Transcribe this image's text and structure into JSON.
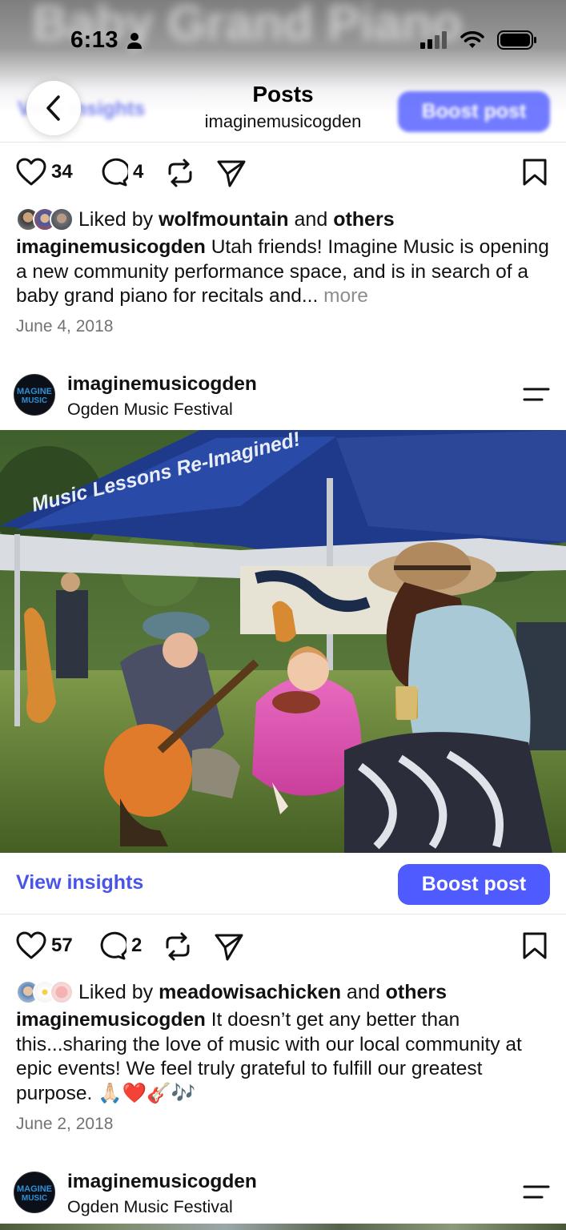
{
  "status_bar": {
    "time": "6:13"
  },
  "background_title": "Baby Grand Piano",
  "nav": {
    "title": "Posts",
    "subtitle": "imaginemusicogden",
    "ghost_left": "View insights",
    "ghost_boost": "Boost post"
  },
  "post1": {
    "likes": "34",
    "comments": "4",
    "liked_prefix": "Liked by",
    "liked_user": "wolfmountain",
    "liked_and": "and",
    "liked_others": "others",
    "caption_user": "imaginemusicogden",
    "caption_text": " Utah friends! Imagine Music is opening a new community performance space, and is in search of a baby grand piano for recitals and... ",
    "more_label": "more",
    "date": "June 4, 2018"
  },
  "post2": {
    "username": "imaginemusicogden",
    "location": "Ogden Music Festival",
    "view_insights": "View insights",
    "boost": "Boost post",
    "likes": "57",
    "comments": "2",
    "liked_prefix": "Liked by",
    "liked_user": "meadowisachicken",
    "liked_and": "and",
    "liked_others": "others",
    "caption_user": "imaginemusicogden",
    "caption_text": " It doesn’t get any better than this...sharing the love of music with our local community at epic events! We feel truly grateful to fulfill our greatest purpose. 🙏🏻❤️🎸🎶",
    "date": "June 2, 2018"
  },
  "post3": {
    "username": "imaginemusicogden",
    "location": "Ogden Music Festival"
  },
  "photo": {
    "banner_text": "Music Lessons Re-Imagined!"
  },
  "colors": {
    "accent": "#4f5bff",
    "link": "#4a55e8",
    "muted": "#737373"
  }
}
